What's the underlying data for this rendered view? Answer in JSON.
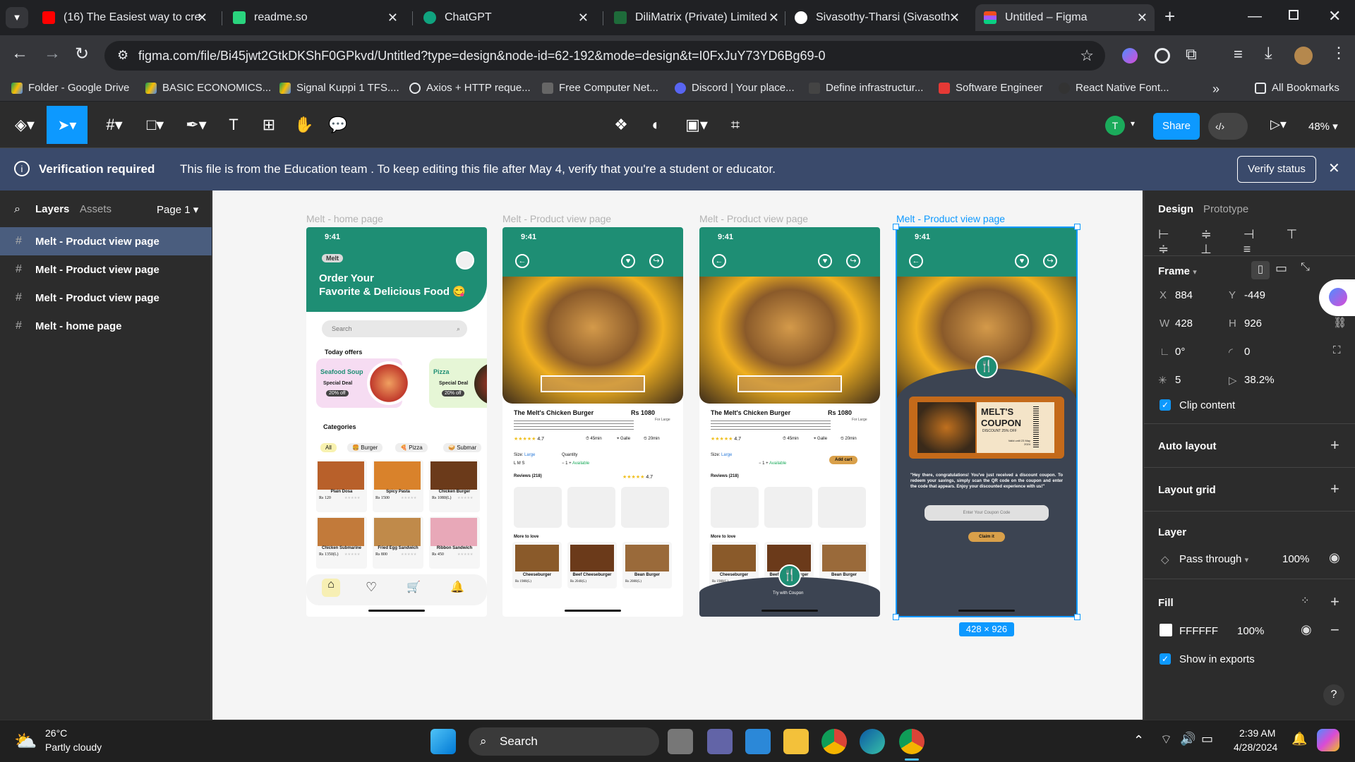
{
  "browser": {
    "tabs": [
      {
        "title": "(16) The Easiest way to cre",
        "color": "#ff0000"
      },
      {
        "title": "readme.so",
        "color": "#2ad47e"
      },
      {
        "title": "ChatGPT",
        "color": "#10a37f"
      },
      {
        "title": "DiliMatrix (Private) Limited",
        "color": "#1e6b3a"
      },
      {
        "title": "Sivasothy-Tharsi (Sivasothy",
        "color": "#ffffff"
      },
      {
        "title": "Untitled – Figma",
        "color": "#f24e1e"
      }
    ],
    "url": "figma.com/file/Bi45jwt2GtkDKShF0GPkvd/Untitled?type=design&node-id=62-192&mode=design&t=I0FxJuY73YD6Bg69-0",
    "bookmarks": [
      "Folder - Google Drive",
      "BASIC ECONOMICS...",
      "Signal Kuppi 1 TFS....",
      "Axios + HTTP reque...",
      "Free Computer Net...",
      "Discord | Your place...",
      "Define infrastructur...",
      "Software Engineer",
      "React Native Font..."
    ],
    "all_bookmarks": "All Bookmarks"
  },
  "toolbar": {
    "avatar_letter": "T",
    "share_label": "Share",
    "zoom": "48%"
  },
  "banner": {
    "title": "Verification required",
    "message": "This file is from the Education team . To keep editing this file after May 4, verify that you're a student or educator.",
    "button": "Verify status"
  },
  "left_panel": {
    "tabs": [
      "Layers",
      "Assets"
    ],
    "page": "Page 1",
    "layers": [
      "Melt - Product view page",
      "Melt - Product view page",
      "Melt - Product view page",
      "Melt - home page"
    ]
  },
  "canvas": {
    "frame_labels": [
      "Melt - home page",
      "Melt - Product view page",
      "Melt - Product view page",
      "Melt - Product view page"
    ],
    "size_badge": "428 × 926",
    "home": {
      "time": "9:41",
      "brand": "Melt",
      "headline1": "Order Your",
      "headline2": "Favorite & Delicious Food 😋",
      "search": "Search",
      "today_offers": "Today offers",
      "offers": [
        {
          "name": "Seafood Soup",
          "deal": "Special Deal",
          "off": "20% off"
        },
        {
          "name": "Pizza",
          "deal": "Special Deal",
          "off": "20% off"
        }
      ],
      "categories_title": "Categories",
      "categories": [
        "All",
        "Burger",
        "Pizza",
        "Submar"
      ],
      "items": [
        {
          "name": "Plain Dosa",
          "price": "Rs 120"
        },
        {
          "name": "Spicy Pasta",
          "price": "Rs 1500"
        },
        {
          "name": "Chicken Burger",
          "price": "Rs 1080(L)"
        },
        {
          "name": "Chicken Submarine",
          "price": "Rs 1350(L)"
        },
        {
          "name": "Fried Egg Sandwich",
          "price": "Rs 800"
        },
        {
          "name": "Ribbon Sandwich",
          "price": "Rs 450"
        }
      ]
    },
    "product": {
      "time": "9:41",
      "title": "The Melt's Chicken Burger",
      "price": "Rs 1080",
      "for": "For Large",
      "rating": "4.7",
      "time_cook": "45min",
      "place": "Galle",
      "delivery": "20min",
      "size_label": "Size:",
      "size_value": "Large",
      "sizes": [
        "L",
        "M",
        "S"
      ],
      "quantity_label": "Quantity",
      "qty": "1",
      "available": "Available",
      "add_cart": "Add cart",
      "reviews": "Reviews (218)",
      "more": "More to love",
      "more_items": [
        {
          "name": "Cheeseburger",
          "price": "Rs 1980(L)"
        },
        {
          "name": "Beef Cheeseburger",
          "price": "Rs 2040(L)"
        },
        {
          "name": "Bean Burger",
          "price": "Rs 2080(L)"
        }
      ],
      "try_coupon": "Try with Coupon"
    },
    "coupon": {
      "title1": "MELT'S",
      "title2": "COUPON",
      "discount": "DISCOUNT 25% OFF",
      "valid": "Valid until 23 May 2024",
      "message": "\"Hey there, congratulations! You've just received a discount coupon. To redeem your savings, simply scan the QR code on the coupon and enter the code that appears. Enjoy your discounted experience with us!\"",
      "input_placeholder": "Enter Your Coupon Code",
      "claim": "Claim it"
    }
  },
  "right_panel": {
    "tabs": [
      "Design",
      "Prototype"
    ],
    "frame": "Frame",
    "x": "884",
    "y": "-449",
    "w": "428",
    "h": "926",
    "rotation": "0°",
    "radius": "0",
    "corner_smoothing": "5",
    "opacity_pct": "38.2%",
    "clip": "Clip content",
    "auto_layout": "Auto layout",
    "layout_grid": "Layout grid",
    "layer": "Layer",
    "blend": "Pass through",
    "layer_opacity": "100%",
    "fill": "Fill",
    "fill_hex": "FFFFFF",
    "fill_opacity": "100%",
    "show_exports": "Show in exports"
  },
  "taskbar": {
    "temp": "26°C",
    "weather": "Partly cloudy",
    "search": "Search",
    "time": "2:39 AM",
    "date": "4/28/2024"
  }
}
